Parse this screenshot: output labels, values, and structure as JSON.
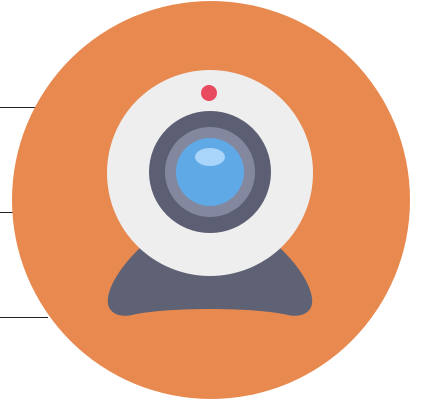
{
  "icon": {
    "name": "webcam-icon",
    "colors": {
      "background": "#E8894F",
      "base": "#5F6275",
      "base_shadow": "#4E5163",
      "housing": "#EEEEEE",
      "lens_ring": "#5C5F73",
      "lens_inner_ring": "#83889E",
      "lens": "#5FA9E6",
      "lens_highlight": "#A9D5FA",
      "indicator": "#E84A5F"
    }
  },
  "guides": [
    {
      "name": "guide-line-top"
    },
    {
      "name": "guide-line-middle"
    },
    {
      "name": "guide-line-bottom"
    }
  ]
}
